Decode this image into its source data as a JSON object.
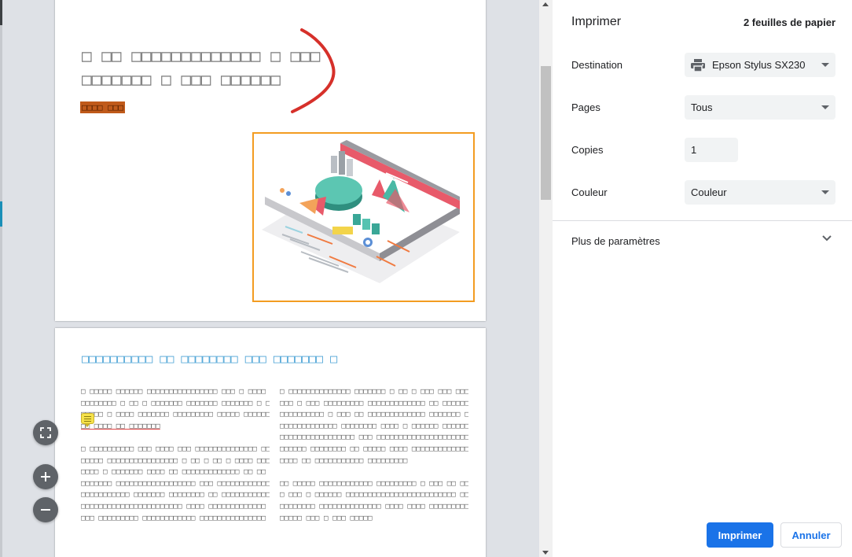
{
  "dialog": {
    "title": "Imprimer",
    "sheet_count": "2 feuilles de papier"
  },
  "settings": {
    "destination": {
      "label": "Destination",
      "value": "Epson Stylus SX230",
      "icon": "printer-icon"
    },
    "pages": {
      "label": "Pages",
      "value": "Tous"
    },
    "copies": {
      "label": "Copies",
      "value": "1"
    },
    "color": {
      "label": "Couleur",
      "value": "Couleur"
    },
    "more": {
      "label": "Plus de paramètres",
      "icon": "chevron-down-icon"
    }
  },
  "actions": {
    "print": "Imprimer",
    "cancel": "Annuler"
  },
  "preview": {
    "zoom_controls": [
      "fit-to-page-icon",
      "zoom-in-icon",
      "zoom-out-icon"
    ]
  },
  "colors": {
    "accent": "#1a73e8",
    "select_bg": "#f1f3f4",
    "preview_bg": "#dee1e6",
    "illustration_border": "#f39c21",
    "annotation_red": "#d6302a",
    "heading_blue": "#4ba3d6"
  }
}
